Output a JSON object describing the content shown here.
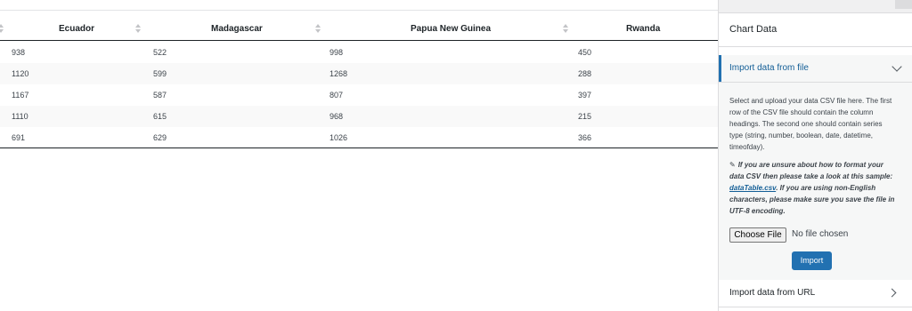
{
  "table": {
    "headers": [
      "Ecuador",
      "Madagascar",
      "Papua New Guinea",
      "Rwanda"
    ],
    "rows": [
      [
        "938",
        "522",
        "998",
        "450"
      ],
      [
        "1120",
        "599",
        "1268",
        "288"
      ],
      [
        "1167",
        "587",
        "807",
        "397"
      ],
      [
        "1110",
        "615",
        "968",
        "215"
      ],
      [
        "691",
        "629",
        "1026",
        "366"
      ]
    ]
  },
  "sidebar": {
    "title": "Chart Data",
    "import_file": {
      "label": "Import data from file",
      "description": "Select and upload your data CSV file here. The first row of the CSV file should contain the column headings. The second one should contain series type (string, number, boolean, date, datetime, timeofday).",
      "hint_before": "If you are unsure about how to format your data CSV then please take a look at this sample: ",
      "hint_link": "dataTable.csv",
      "hint_after": ". If you are using non-English characters, please make sure you save the file in UTF-8 encoding.",
      "choose_file_label": "Choose File",
      "no_file_text": "No file chosen",
      "import_button": "Import"
    },
    "import_url": {
      "label": "Import data from URL"
    }
  },
  "colors": {
    "accent": "#2271b1",
    "link": "#135e96"
  }
}
